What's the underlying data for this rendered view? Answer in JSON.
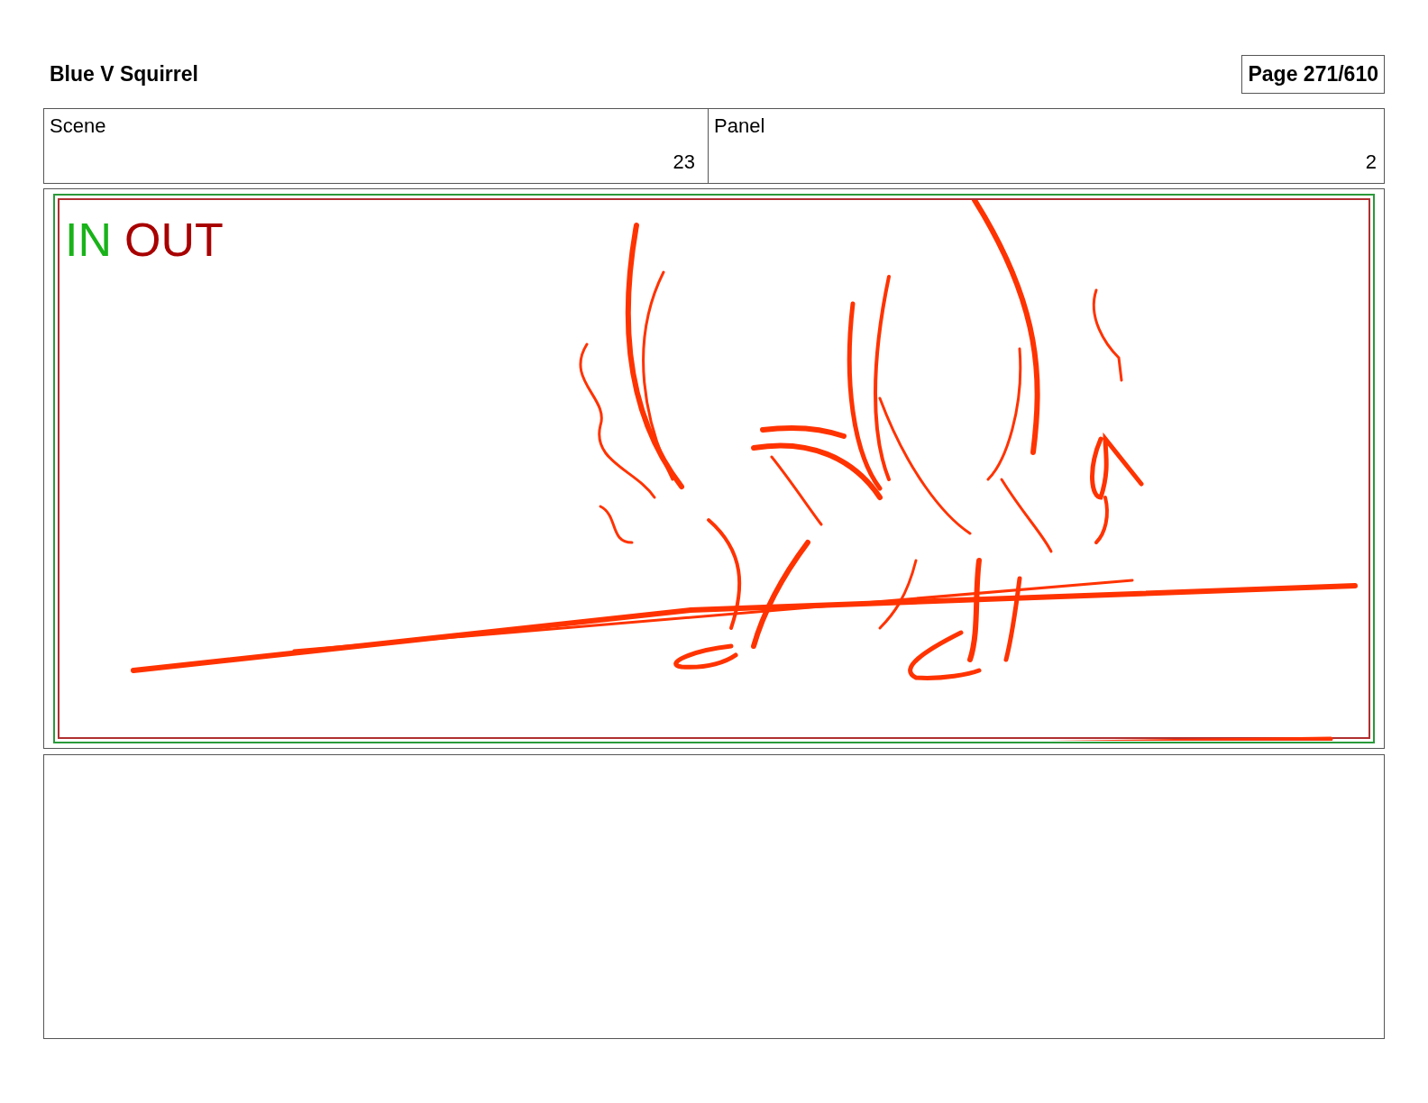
{
  "title": "Blue V Squirrel",
  "page": "Page 271/610",
  "fields": [
    {
      "label": "Scene",
      "value": "23"
    },
    {
      "label": "Panel",
      "value": "2"
    }
  ],
  "panel": {
    "in_mark": "IN",
    "out_mark": "OUT"
  }
}
